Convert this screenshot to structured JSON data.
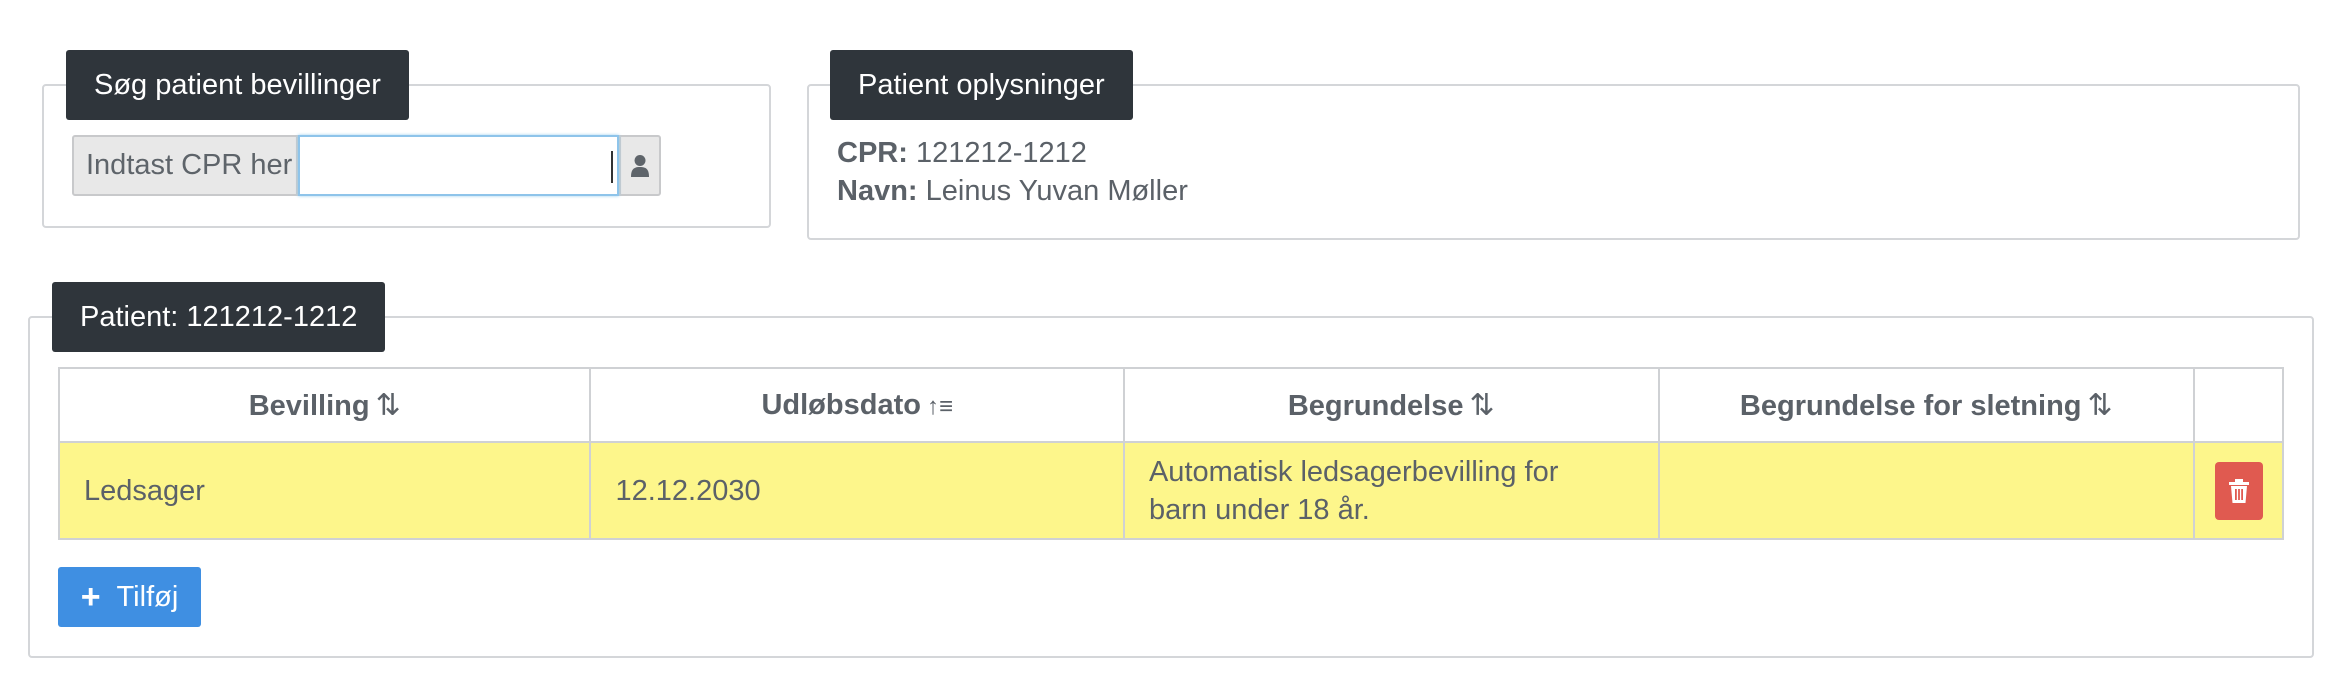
{
  "search": {
    "legend": "Søg patient bevillinger",
    "addon_label": "Indtast CPR her",
    "input_value": "",
    "button_icon": "user-icon"
  },
  "patient_info": {
    "legend": "Patient oplysninger",
    "cpr_label": "CPR:",
    "cpr_value": "121212-1212",
    "name_label": "Navn:",
    "name_value": "Leinus Yuvan Møller"
  },
  "grants": {
    "legend": "Patient: 121212-1212",
    "columns": [
      {
        "label": "Bevilling",
        "sort_icon": "⇅"
      },
      {
        "label": "Udløbsdato",
        "sort_icon": "↑≡"
      },
      {
        "label": "Begrundelse",
        "sort_icon": "⇅"
      },
      {
        "label": "Begrundelse for sletning",
        "sort_icon": "⇅"
      }
    ],
    "rows": [
      {
        "bevilling": "Ledsager",
        "udlobsdato": "12.12.2030",
        "begrundelse_line1": "Automatisk ledsagerbevilling for",
        "begrundelse_line2": "barn under 18 år.",
        "begrundelse_sletning": "",
        "highlight_color": "#fdf68b"
      }
    ],
    "add_button": "Tilføj"
  },
  "colors": {
    "legend_bg": "#2f353b",
    "add_button": "#3f8fe2",
    "delete_button": "#e05a50"
  }
}
